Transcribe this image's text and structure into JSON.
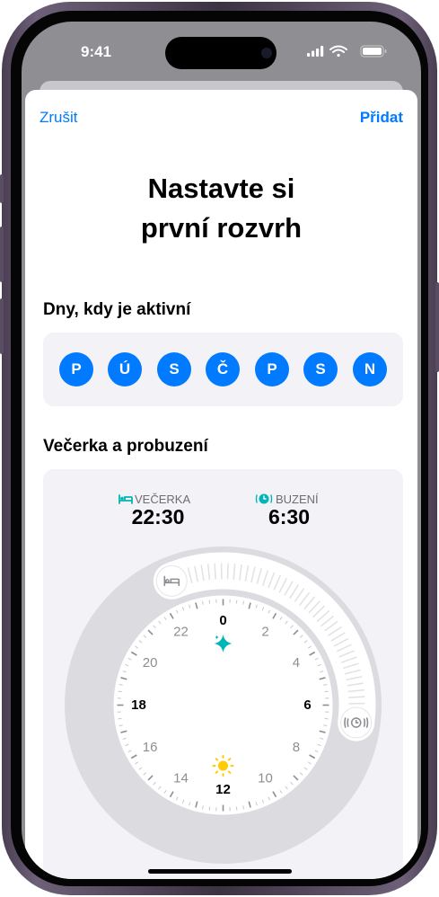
{
  "status": {
    "time": "9:41"
  },
  "nav": {
    "cancel": "Zrušit",
    "add": "Přidat"
  },
  "title": {
    "line1": "Nastavte si",
    "line2": "první rozvrh"
  },
  "days": {
    "heading": "Dny, kdy je aktivní",
    "items": [
      "P",
      "Ú",
      "S",
      "Č",
      "P",
      "S",
      "N"
    ]
  },
  "schedule": {
    "heading": "Večerka a probuzení",
    "bedtime": {
      "label": "VEČERKA",
      "value": "22:30"
    },
    "wake": {
      "label": "BUZENÍ",
      "value": "6:30"
    },
    "clock_numbers": [
      "0",
      "2",
      "4",
      "6",
      "8",
      "10",
      "12",
      "14",
      "16",
      "18",
      "20",
      "22"
    ]
  },
  "icons": {
    "bed": "bed-icon",
    "alarm": "alarm-icon",
    "sparkles": "sparkles-icon",
    "sun": "sun-icon"
  },
  "colors": {
    "accent": "#007aff",
    "bedtime_teal": "#00b5b8",
    "sun": "#ffcc00"
  }
}
